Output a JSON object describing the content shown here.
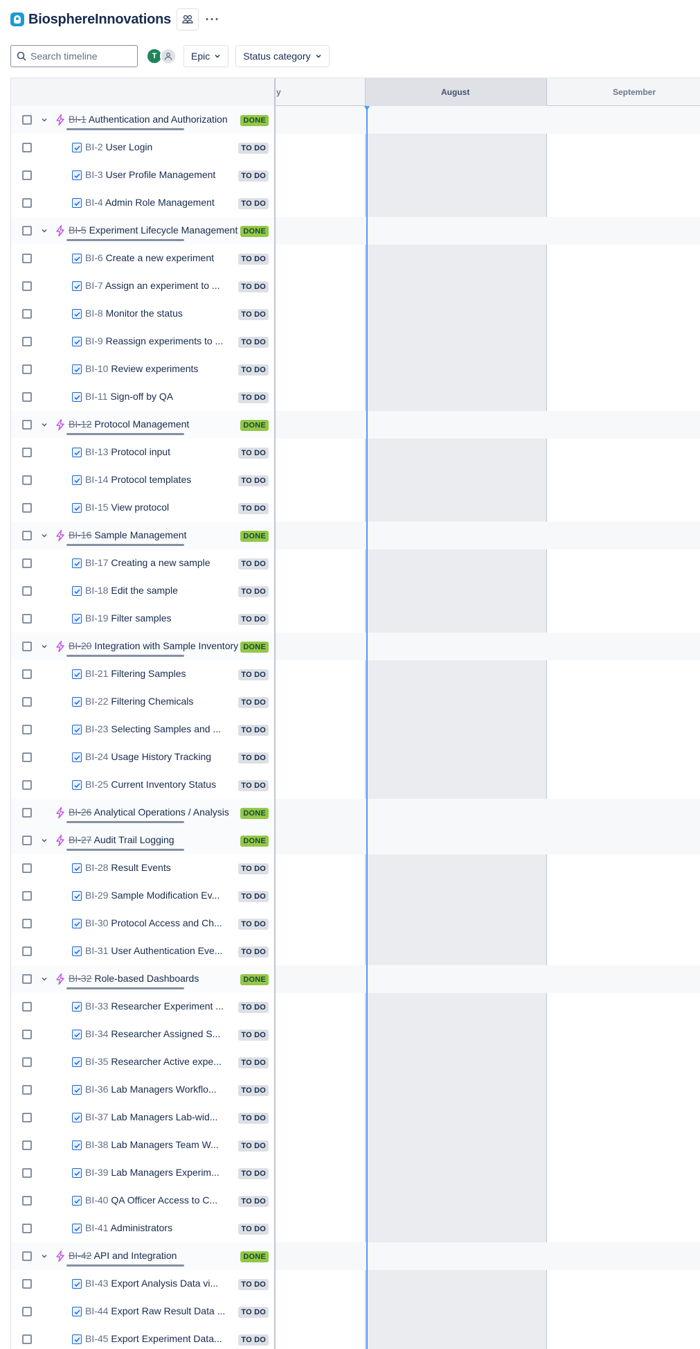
{
  "header": {
    "project_title": "BiosphereInnovations",
    "logo_icon": "jira-robot-logo-icon",
    "team_icon": "people-icon",
    "more_icon": "more-horizontal-icon",
    "more_label": "···"
  },
  "toolbar": {
    "search_placeholder": "Search timeline",
    "avatar_initial": "T",
    "filters": [
      {
        "label": "Epic"
      },
      {
        "label": "Status category"
      }
    ]
  },
  "timeline": {
    "months": [
      {
        "label": "y"
      },
      {
        "label": "August"
      },
      {
        "label": "September"
      }
    ]
  },
  "colors": {
    "done": "#94c748",
    "todo": "#dcdfe4",
    "today_line": "#4c9aff",
    "epic_icon": "#c554e0",
    "story_icon": "#1868db"
  },
  "rows": [
    {
      "type": "epic",
      "expandable": true,
      "key": "BI-1",
      "title": "Authentication and Authorization",
      "status": "DONE"
    },
    {
      "type": "story",
      "key": "BI-2",
      "title": "User Login",
      "status": "TO DO"
    },
    {
      "type": "story",
      "key": "BI-3",
      "title": "User Profile Management",
      "status": "TO DO"
    },
    {
      "type": "story",
      "key": "BI-4",
      "title": "Admin Role Management",
      "status": "TO DO"
    },
    {
      "type": "epic",
      "expandable": true,
      "key": "BI-5",
      "title": "Experiment Lifecycle Management",
      "status": "DONE"
    },
    {
      "type": "story",
      "key": "BI-6",
      "title": "Create a new experiment",
      "status": "TO DO"
    },
    {
      "type": "story",
      "key": "BI-7",
      "title": "Assign an experiment to ...",
      "status": "TO DO"
    },
    {
      "type": "story",
      "key": "BI-8",
      "title": "Monitor the status",
      "status": "TO DO"
    },
    {
      "type": "story",
      "key": "BI-9",
      "title": "Reassign experiments to ...",
      "status": "TO DO"
    },
    {
      "type": "story",
      "key": "BI-10",
      "title": "Review experiments",
      "status": "TO DO"
    },
    {
      "type": "story",
      "key": "BI-11",
      "title": "Sign-off by QA",
      "status": "TO DO"
    },
    {
      "type": "epic",
      "expandable": true,
      "key": "BI-12",
      "title": "Protocol Management",
      "status": "DONE"
    },
    {
      "type": "story",
      "key": "BI-13",
      "title": "Protocol input",
      "status": "TO DO"
    },
    {
      "type": "story",
      "key": "BI-14",
      "title": "Protocol templates",
      "status": "TO DO"
    },
    {
      "type": "story",
      "key": "BI-15",
      "title": "View protocol",
      "status": "TO DO"
    },
    {
      "type": "epic",
      "expandable": true,
      "key": "BI-16",
      "title": "Sample Management",
      "status": "DONE"
    },
    {
      "type": "story",
      "key": "BI-17",
      "title": "Creating a new sample",
      "status": "TO DO"
    },
    {
      "type": "story",
      "key": "BI-18",
      "title": "Edit the sample",
      "status": "TO DO"
    },
    {
      "type": "story",
      "key": "BI-19",
      "title": "Filter samples",
      "status": "TO DO"
    },
    {
      "type": "epic",
      "expandable": true,
      "key": "BI-20",
      "title": "Integration with Sample Inventory",
      "status": "DONE"
    },
    {
      "type": "story",
      "key": "BI-21",
      "title": "Filtering Samples",
      "status": "TO DO"
    },
    {
      "type": "story",
      "key": "BI-22",
      "title": "Filtering Chemicals",
      "status": "TO DO"
    },
    {
      "type": "story",
      "key": "BI-23",
      "title": "Selecting Samples and ...",
      "status": "TO DO"
    },
    {
      "type": "story",
      "key": "BI-24",
      "title": "Usage History Tracking",
      "status": "TO DO"
    },
    {
      "type": "story",
      "key": "BI-25",
      "title": "Current Inventory Status",
      "status": "TO DO"
    },
    {
      "type": "epic",
      "expandable": false,
      "key": "BI-26",
      "title": "Analytical Operations / Analysis",
      "status": "DONE"
    },
    {
      "type": "epic",
      "expandable": true,
      "key": "BI-27",
      "title": "Audit Trail Logging",
      "status": "DONE"
    },
    {
      "type": "story",
      "key": "BI-28",
      "title": "Result Events",
      "status": "TO DO"
    },
    {
      "type": "story",
      "key": "BI-29",
      "title": "Sample Modification Ev...",
      "status": "TO DO"
    },
    {
      "type": "story",
      "key": "BI-30",
      "title": "Protocol Access and Ch...",
      "status": "TO DO"
    },
    {
      "type": "story",
      "key": "BI-31",
      "title": "User Authentication Eve...",
      "status": "TO DO"
    },
    {
      "type": "epic",
      "expandable": true,
      "key": "BI-32",
      "title": "Role-based Dashboards",
      "status": "DONE"
    },
    {
      "type": "story",
      "key": "BI-33",
      "title": "Researcher Experiment ...",
      "status": "TO DO"
    },
    {
      "type": "story",
      "key": "BI-34",
      "title": "Researcher Assigned S...",
      "status": "TO DO"
    },
    {
      "type": "story",
      "key": "BI-35",
      "title": "Researcher Active expe...",
      "status": "TO DO"
    },
    {
      "type": "story",
      "key": "BI-36",
      "title": "Lab Managers Workflo...",
      "status": "TO DO"
    },
    {
      "type": "story",
      "key": "BI-37",
      "title": "Lab Managers Lab-wid...",
      "status": "TO DO"
    },
    {
      "type": "story",
      "key": "BI-38",
      "title": "Lab Managers Team W...",
      "status": "TO DO"
    },
    {
      "type": "story",
      "key": "BI-39",
      "title": "Lab Managers Experim...",
      "status": "TO DO"
    },
    {
      "type": "story",
      "key": "BI-40",
      "title": "QA Officer Access to C...",
      "status": "TO DO"
    },
    {
      "type": "story",
      "key": "BI-41",
      "title": "Administrators",
      "status": "TO DO"
    },
    {
      "type": "epic",
      "expandable": true,
      "key": "BI-42",
      "title": "API and Integration",
      "status": "DONE"
    },
    {
      "type": "story",
      "key": "BI-43",
      "title": "Export Analysis Data vi...",
      "status": "TO DO"
    },
    {
      "type": "story",
      "key": "BI-44",
      "title": "Export Raw Result Data ...",
      "status": "TO DO"
    },
    {
      "type": "story",
      "key": "BI-45",
      "title": "Export Experiment Data...",
      "status": "TO DO"
    }
  ]
}
